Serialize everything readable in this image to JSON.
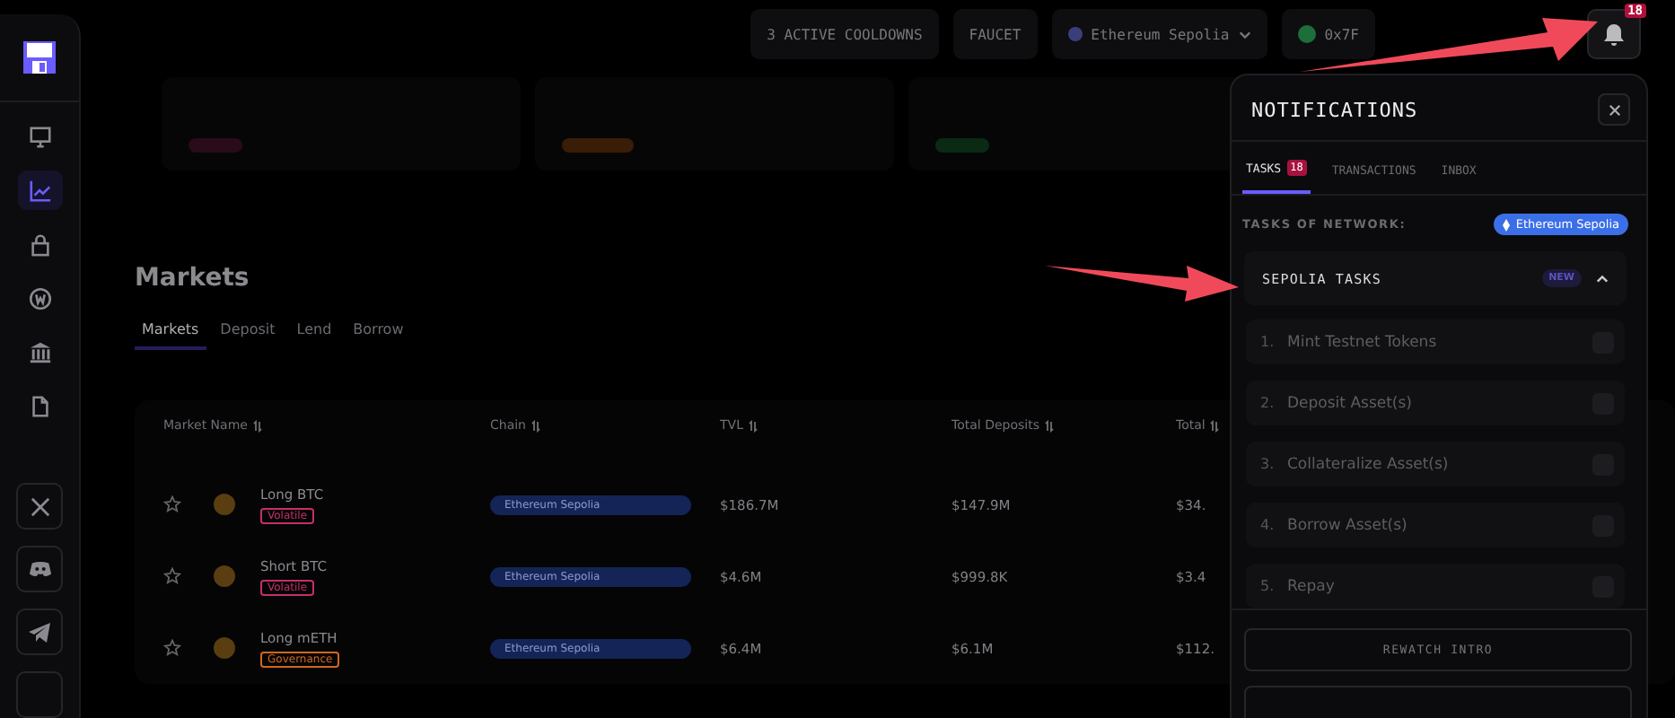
{
  "sidebar": {
    "items": [
      {
        "kind": "desktop",
        "selected": false
      },
      {
        "kind": "chart",
        "selected": true
      },
      {
        "kind": "lock",
        "selected": false
      },
      {
        "kind": "coin",
        "selected": false
      },
      {
        "kind": "bank",
        "selected": false
      },
      {
        "kind": "document",
        "selected": false
      }
    ],
    "social_links": [
      {
        "kind": "x"
      },
      {
        "kind": "discord"
      },
      {
        "kind": "telegram"
      }
    ]
  },
  "top_bar": {
    "cooldowns": "3 ACTIVE COOLDOWNS",
    "faucet": "FAUCET",
    "network": "Ethereum Sepolia",
    "wallet": "0x7F",
    "notification_count": "18"
  },
  "page": {
    "title": "Markets",
    "tabs": [
      {
        "label": "Markets",
        "selected": true
      },
      {
        "label": "Deposit",
        "selected": false
      },
      {
        "label": "Lend",
        "selected": false
      },
      {
        "label": "Borrow",
        "selected": false
      }
    ],
    "table": {
      "columns": [
        "Market Name",
        "Chain",
        "TVL",
        "Total Deposits",
        "Total"
      ],
      "rows": [
        {
          "name": "Long BTC",
          "tag": {
            "label": "Volatile",
            "color": "#c2306a"
          },
          "chain": "Ethereum Sepolia",
          "tvl": "$186.7M",
          "deposits": "$147.9M",
          "total": "$34."
        },
        {
          "name": "Short BTC",
          "tag": {
            "label": "Volatile",
            "color": "#c2306a"
          },
          "chain": "Ethereum Sepolia",
          "tvl": "$4.6M",
          "deposits": "$999.8K",
          "total": "$3.4"
        },
        {
          "name": "Long mETH",
          "tag": {
            "label": "Governance",
            "color": "#d0671e"
          },
          "chain": "Ethereum Sepolia",
          "tvl": "$6.4M",
          "deposits": "$6.1M",
          "total": "$112."
        }
      ]
    }
  },
  "notifications": {
    "title": "NOTIFICATIONS",
    "tabs": [
      {
        "label": "TASKS",
        "count": "18",
        "selected": true
      },
      {
        "label": "TRANSACTIONS",
        "selected": false
      },
      {
        "label": "INBOX",
        "selected": false
      }
    ],
    "network_label": "TASKS OF NETWORK:",
    "network": "Ethereum Sepolia",
    "section": {
      "title": "SEPOLIA TASKS",
      "badge": "NEW",
      "expanded": true
    },
    "tasks": [
      {
        "number": "1.",
        "label": "Mint Testnet Tokens",
        "checked": false
      },
      {
        "number": "2.",
        "label": "Deposit Asset(s)",
        "checked": false
      },
      {
        "number": "3.",
        "label": "Collateralize Asset(s)",
        "checked": false
      },
      {
        "number": "4.",
        "label": "Borrow Asset(s)",
        "checked": false
      },
      {
        "number": "5.",
        "label": "Repay",
        "checked": false
      }
    ],
    "button": "REWATCH INTRO"
  }
}
